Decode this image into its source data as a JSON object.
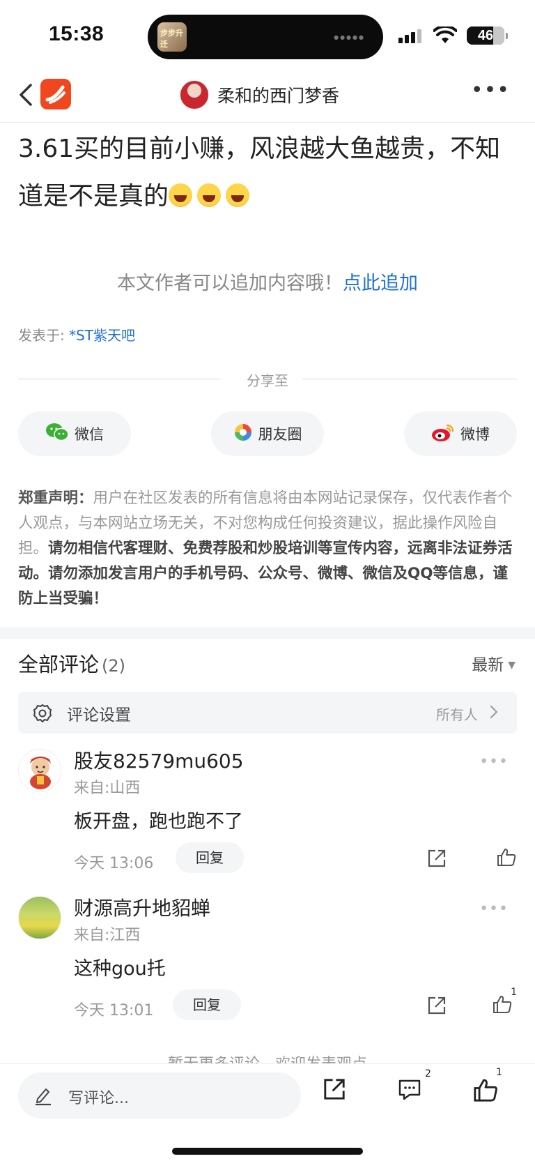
{
  "status_bar": {
    "time": "15:38",
    "battery": "46",
    "island_app_label": "步步升迁"
  },
  "nav": {
    "author_name": "柔和的西门梦香",
    "icons": [
      "back-chevron-icon",
      "app-logo-icon",
      "more-icon"
    ]
  },
  "post": {
    "text": "3.61买的目前小赚，风浪越大鱼越贵，不知道是不是真的",
    "emojis": [
      "laughing-emoji",
      "laughing-emoji",
      "laughing-emoji"
    ],
    "append_prompt": "本文作者可以追加内容哦！",
    "append_link": "点此追加",
    "posted_in_label": "发表于:",
    "posted_in_forum": "*ST紫天吧"
  },
  "share": {
    "label": "分享至",
    "buttons": [
      {
        "label": "微信",
        "icon": "wechat-icon"
      },
      {
        "label": "朋友圈",
        "icon": "moments-icon"
      },
      {
        "label": "微博",
        "icon": "weibo-icon"
      }
    ]
  },
  "disclaimer": {
    "title": "郑重声明：",
    "text": "用户在社区发表的所有信息将由本网站记录保存，仅代表作者个人观点，与本网站立场无关，不对您构成任何投资建议，据此操作风险自担。",
    "strong": "请勿相信代客理财、免费荐股和炒股培训等宣传内容，远离非法证券活动。请勿添加发言用户的手机号码、公众号、微博、微信及QQ等信息，谨防上当受骗！"
  },
  "comments_section": {
    "title": "全部评论",
    "count": "(2)",
    "sort": "最新",
    "settings_label": "评论设置",
    "settings_value": "所有人"
  },
  "comments": [
    {
      "name": "股友82579mu605",
      "location": "来自:山西",
      "text": "板开盘，跑也跑不了",
      "time": "今天 13:06",
      "reply": "回复",
      "likes": ""
    },
    {
      "name": "财源高升地貂蝉",
      "location": "来自:江西",
      "text": "这种gou托",
      "time": "今天 13:01",
      "reply": "回复",
      "likes": "1"
    }
  ],
  "no_more": "暂无更多评论，欢迎发表观点",
  "bottom_bar": {
    "write_placeholder": "写评论...",
    "comment_count": "2",
    "like_count": "1"
  },
  "colors": {
    "accent_blue": "#1f6fd6",
    "brand_orange": "#f0471e",
    "muted_gray": "#999999"
  }
}
